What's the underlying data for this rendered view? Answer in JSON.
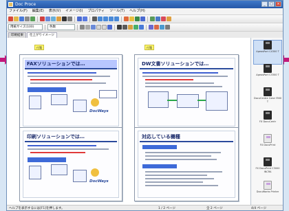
{
  "window": {
    "title": "Doc Proce",
    "controls": [
      "_",
      "□",
      "×"
    ]
  },
  "menu": [
    "ファイル(F)",
    "編集(E)",
    "表示(V)",
    "イメージ(I)",
    "プロパティ",
    "ツール(T)",
    "ヘルプ(H)"
  ],
  "toolbar2": {
    "zoom_combo": "用紙サイズ(100)",
    "color_combo": "色数"
  },
  "tabs": [
    "印刷結果",
    "仕上がりイメージ"
  ],
  "notes": {
    "left": "付箋",
    "right": "付箋"
  },
  "pages": [
    {
      "title": "FAXソリューションでは…",
      "logo": "DocWays"
    },
    {
      "title": "DW文書ソリューションでは…",
      "logo": ""
    },
    {
      "title": "印刷ソリューションでは…",
      "logo": "DocWays"
    },
    {
      "title": "対応している機種",
      "logo": ""
    }
  ],
  "sidepanel": {
    "items": [
      {
        "label": "ApeosPort C4300 T",
        "icon": "printer-icon",
        "style": "dark"
      },
      {
        "label": "ApeosPort C3300 T",
        "icon": "printer-icon",
        "style": "dark"
      },
      {
        "label": "DocuCentre Color f360 T",
        "icon": "printer-icon",
        "style": "dark"
      },
      {
        "label": "FX DocuCentr",
        "icon": "printer-icon",
        "style": "dark"
      },
      {
        "label": "FX DocuPrint",
        "icon": "printer-icon",
        "style": "light"
      },
      {
        "label": "FX DocuPrint C3000 INCRA",
        "icon": "printer-icon",
        "style": "dark"
      },
      {
        "label": "DocuWorks Printer",
        "icon": "printer-icon",
        "style": "light"
      }
    ]
  },
  "status": {
    "help": "ヘルプを表示するには[F1]を押します。",
    "page": "1 / 2 ページ",
    "zoom": "全 2 ページ",
    "count": "4/4 ページ"
  },
  "colors": {
    "accent": "#2a4a9c",
    "highlight": "#b8c6ff",
    "arrow": "#c2187a"
  }
}
